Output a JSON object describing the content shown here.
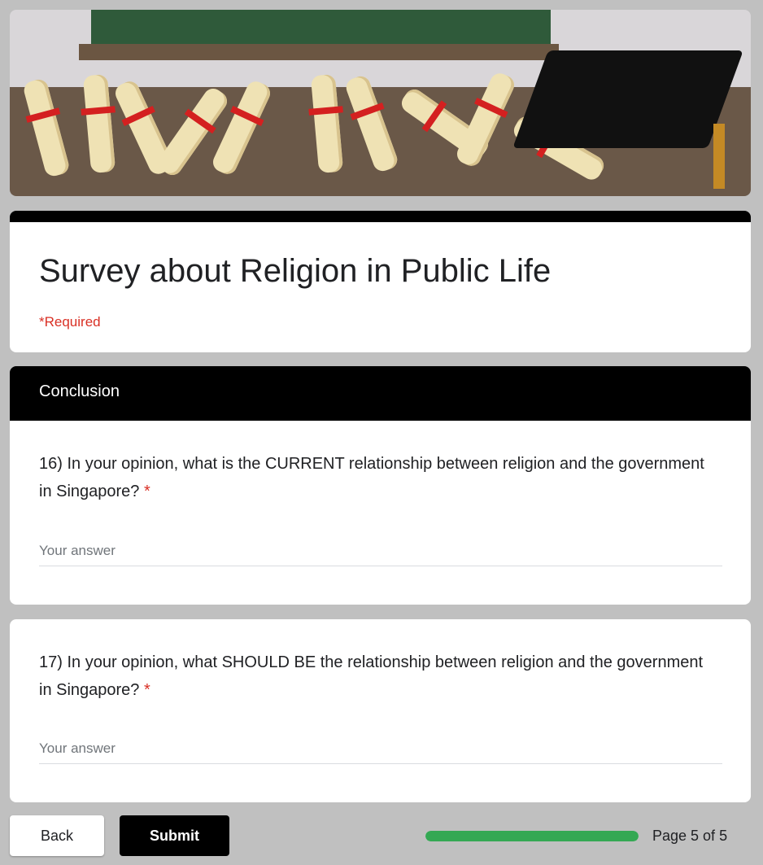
{
  "form": {
    "title": "Survey about Religion in Public Life",
    "required_note": "*Required",
    "section_title": "Conclusion",
    "questions": [
      {
        "text": "16) In your opinion, what is the CURRENT relationship between religion and the government in Singapore?",
        "required_mark": "*",
        "placeholder": "Your answer"
      },
      {
        "text": "17) In your opinion, what SHOULD BE the relationship between religion and the government in Singapore?",
        "required_mark": "*",
        "placeholder": "Your answer"
      }
    ]
  },
  "footer": {
    "back_label": "Back",
    "submit_label": "Submit",
    "progress_fraction": 1.0,
    "page_label": "Page 5 of 5"
  },
  "colors": {
    "accent": "#000000",
    "progress": "#34a853",
    "required": "#d93025",
    "background": "#c0c0c0"
  }
}
